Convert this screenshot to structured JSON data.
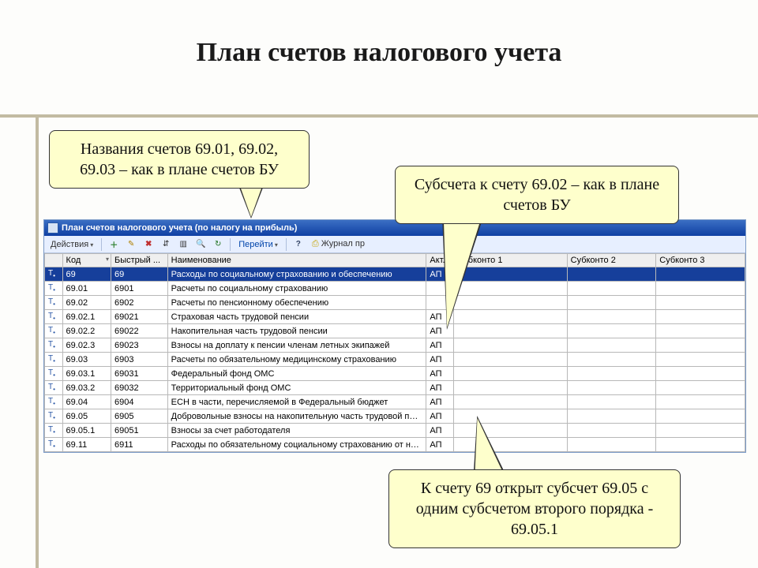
{
  "slide": {
    "title": "План счетов налогового учета"
  },
  "callouts": {
    "c1": "Названия счетов 69.01, 69.02, 69.03 – как в плане счетов БУ",
    "c2": "Субсчета к счету 69.02 – как в плане счетов БУ",
    "c3": "К счету 69 открыт субсчет 69.05 с одним субсчетом второго порядка - 69.05.1"
  },
  "window": {
    "title": "План счетов налогового учета (по налогу на прибыль)",
    "toolbar": {
      "actions_label": "Действия",
      "goto_label": "Перейти",
      "journal_label": "Журнал пр"
    },
    "columns": {
      "code": "Код",
      "fast": "Быстрый ...",
      "name": "Наименование",
      "act": "Акт.",
      "sub1": "Субконто 1",
      "sub2": "Субконто 2",
      "sub3": "Субконто 3"
    },
    "rows": [
      {
        "code": "69",
        "fast": "69",
        "name": "Расходы по социальному страхованию и обеспечению",
        "act": "АП",
        "selected": true
      },
      {
        "code": "69.01",
        "fast": "6901",
        "name": "Расчеты по социальному страхованию",
        "act": ""
      },
      {
        "code": "69.02",
        "fast": "6902",
        "name": "Расчеты по пенсионному обеспечению",
        "act": ""
      },
      {
        "code": "69.02.1",
        "fast": "69021",
        "name": "Страховая часть трудовой пенсии",
        "act": "АП"
      },
      {
        "code": "69.02.2",
        "fast": "69022",
        "name": "Накопительная часть трудовой пенсии",
        "act": "АП"
      },
      {
        "code": "69.02.3",
        "fast": "69023",
        "name": "Взносы на доплату к пенсии членам летных экипажей",
        "act": "АП"
      },
      {
        "code": "69.03",
        "fast": "6903",
        "name": "Расчеты по обязательному медицинскому страхованию",
        "act": "АП"
      },
      {
        "code": "69.03.1",
        "fast": "69031",
        "name": "Федеральный фонд ОМС",
        "act": "АП"
      },
      {
        "code": "69.03.2",
        "fast": "69032",
        "name": "Территориальный фонд ОМС",
        "act": "АП"
      },
      {
        "code": "69.04",
        "fast": "6904",
        "name": "ЕСН в части, перечисляемой в Федеральный бюджет",
        "act": "АП"
      },
      {
        "code": "69.05",
        "fast": "6905",
        "name": "Добровольные взносы на накопительную часть трудовой пен...",
        "act": "АП"
      },
      {
        "code": "69.05.1",
        "fast": "69051",
        "name": "Взносы за счет работодателя",
        "act": "АП"
      },
      {
        "code": "69.11",
        "fast": "6911",
        "name": "Расходы по обязательному социальному страхованию от нес...",
        "act": "АП"
      }
    ]
  }
}
